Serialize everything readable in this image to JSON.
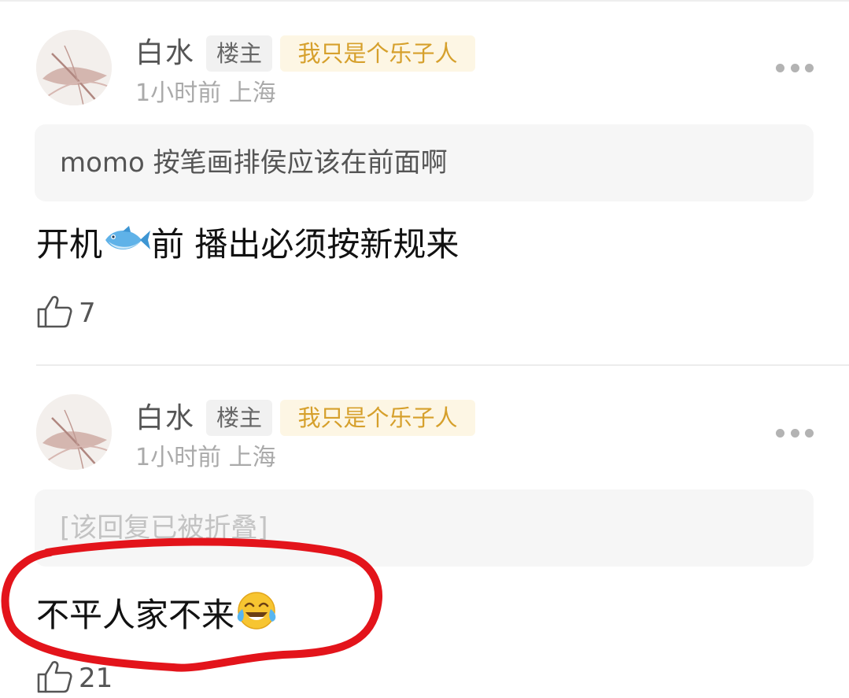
{
  "comments": [
    {
      "username": "白水",
      "owner_badge": "楼主",
      "title_badge": "我只是个乐子人",
      "meta": "1小时前 上海",
      "quote": "momo 按笔画排侯应该在前面啊",
      "body_before": "开机",
      "body_emoji": "fish-emoji",
      "body_after": "前  播出必须按新规来",
      "likes": "7"
    },
    {
      "username": "白水",
      "owner_badge": "楼主",
      "title_badge": "我只是个乐子人",
      "meta": "1小时前 上海",
      "quote": "[该回复已被折叠]",
      "body_before": "不平人家不来",
      "body_emoji": "tears-of-joy-emoji",
      "likes": "21"
    }
  ],
  "colors": {
    "title_badge_text": "#d6a02c",
    "title_badge_bg": "#fdf6e4",
    "highlight_circle": "#e3141b"
  }
}
